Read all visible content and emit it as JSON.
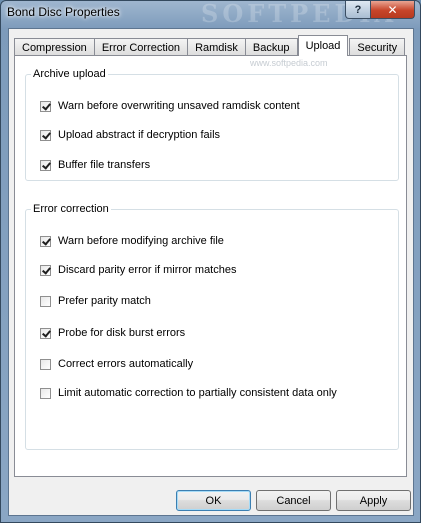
{
  "window": {
    "title": "Bond Disc Properties",
    "watermark": "SOFTPEDIA",
    "help_label": "?",
    "close_label": "✕"
  },
  "tabs": [
    {
      "label": "Compression",
      "active": false
    },
    {
      "label": "Error Correction",
      "active": false
    },
    {
      "label": "Ramdisk",
      "active": false
    },
    {
      "label": "Backup",
      "active": false
    },
    {
      "label": "Upload",
      "active": true
    },
    {
      "label": "Security",
      "active": false
    }
  ],
  "panel": {
    "watermark_text": "www.softpedia.com",
    "archive_upload": {
      "legend": "Archive upload",
      "options": [
        {
          "label": "Warn before overwriting unsaved ramdisk content",
          "checked": true
        },
        {
          "label": "Upload abstract if decryption fails",
          "checked": true
        },
        {
          "label": "Buffer file transfers",
          "checked": true
        }
      ]
    },
    "error_correction": {
      "legend": "Error correction",
      "options": [
        {
          "label": "Warn before modifying archive file",
          "checked": true
        },
        {
          "label": "Discard parity error if mirror matches",
          "checked": true
        },
        {
          "label": "Prefer parity match",
          "checked": false
        },
        {
          "label": "Probe for disk burst errors",
          "checked": true
        },
        {
          "label": "Correct errors automatically",
          "checked": false
        },
        {
          "label": "Limit automatic correction to partially consistent data only",
          "checked": false
        }
      ]
    }
  },
  "buttons": {
    "ok": "OK",
    "cancel": "Cancel",
    "apply": "Apply"
  }
}
